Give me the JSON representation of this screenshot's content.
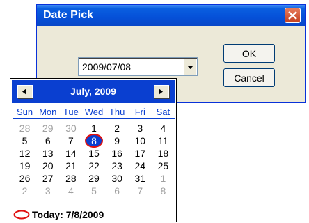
{
  "dialog": {
    "title": "Date Pick",
    "date_value": "2009/07/08",
    "ok_label": "OK",
    "cancel_label": "Cancel"
  },
  "calendar": {
    "month_label": "July, 2009",
    "weekdays": [
      "Sun",
      "Mon",
      "Tue",
      "Wed",
      "Thu",
      "Fri",
      "Sat"
    ],
    "days": [
      {
        "label": "28",
        "other": true
      },
      {
        "label": "29",
        "other": true
      },
      {
        "label": "30",
        "other": true
      },
      {
        "label": "1"
      },
      {
        "label": "2"
      },
      {
        "label": "3"
      },
      {
        "label": "4"
      },
      {
        "label": "5"
      },
      {
        "label": "6"
      },
      {
        "label": "7"
      },
      {
        "label": "8",
        "selected": true
      },
      {
        "label": "9"
      },
      {
        "label": "10"
      },
      {
        "label": "11"
      },
      {
        "label": "12"
      },
      {
        "label": "13"
      },
      {
        "label": "14"
      },
      {
        "label": "15"
      },
      {
        "label": "16"
      },
      {
        "label": "17"
      },
      {
        "label": "18"
      },
      {
        "label": "19"
      },
      {
        "label": "20"
      },
      {
        "label": "21"
      },
      {
        "label": "22"
      },
      {
        "label": "23"
      },
      {
        "label": "24"
      },
      {
        "label": "25"
      },
      {
        "label": "26"
      },
      {
        "label": "27"
      },
      {
        "label": "28"
      },
      {
        "label": "29"
      },
      {
        "label": "30"
      },
      {
        "label": "31"
      },
      {
        "label": "1",
        "other": true
      },
      {
        "label": "2",
        "other": true
      },
      {
        "label": "3",
        "other": true
      },
      {
        "label": "4",
        "other": true
      },
      {
        "label": "5",
        "other": true
      },
      {
        "label": "6",
        "other": true
      },
      {
        "label": "7",
        "other": true
      },
      {
        "label": "8",
        "other": true
      }
    ],
    "today_label": "Today: 7/8/2009"
  },
  "icons": {
    "close": "close-icon",
    "dropdown": "chevron-down-icon",
    "prev": "chevron-left-icon",
    "next": "chevron-right-icon",
    "today": "today-circle-icon"
  },
  "colors": {
    "accent": "#0a3fd0",
    "today_marker": "#e01010",
    "other_month": "#a0a0a0"
  }
}
